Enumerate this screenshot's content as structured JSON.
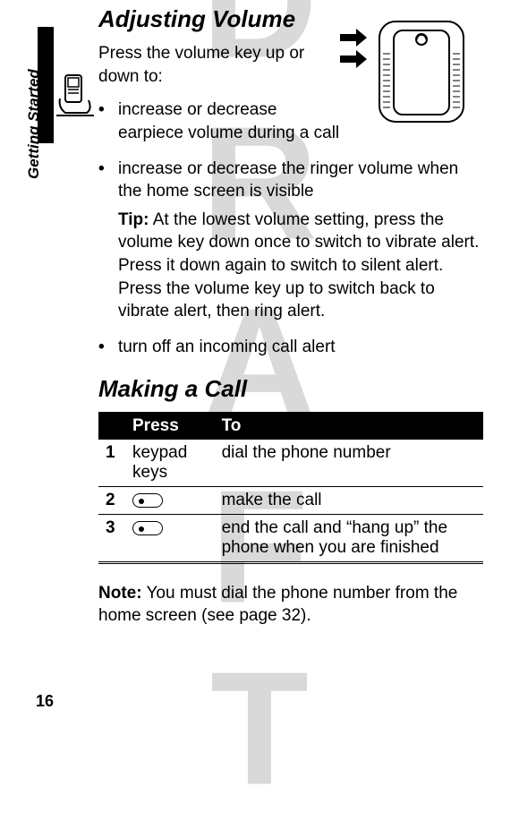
{
  "watermark": "DRAFT",
  "side_tab": "Getting Started",
  "page_number": "16",
  "section1": {
    "heading": "Adjusting Volume",
    "intro": "Press the volume key up or down to:",
    "bullets": [
      {
        "text": "increase or decrease earpiece volume during a call"
      },
      {
        "text": "increase or decrease the ringer volume when the home screen is visible",
        "tip_label": "Tip:",
        "tip": " At the lowest volume setting, press the volume key down once to switch to vibrate alert. Press it down again to switch to silent alert. Press the volume key up to switch back to vibrate alert, then ring alert."
      },
      {
        "text": "turn off an incoming call alert"
      }
    ]
  },
  "section2": {
    "heading": "Making a Call",
    "table": {
      "headers": [
        "",
        "Press",
        "To"
      ],
      "rows": [
        {
          "num": "1",
          "press": "keypad keys",
          "to": "dial the phone number"
        },
        {
          "num": "2",
          "press_icon": "send-key-icon",
          "to": "make the call"
        },
        {
          "num": "3",
          "press_icon": "end-key-icon",
          "to": "end the call and “hang up” the phone when you are finished"
        }
      ]
    },
    "note_label": "Note:",
    "note": " You must dial the phone number from the home screen (see page 32)."
  }
}
